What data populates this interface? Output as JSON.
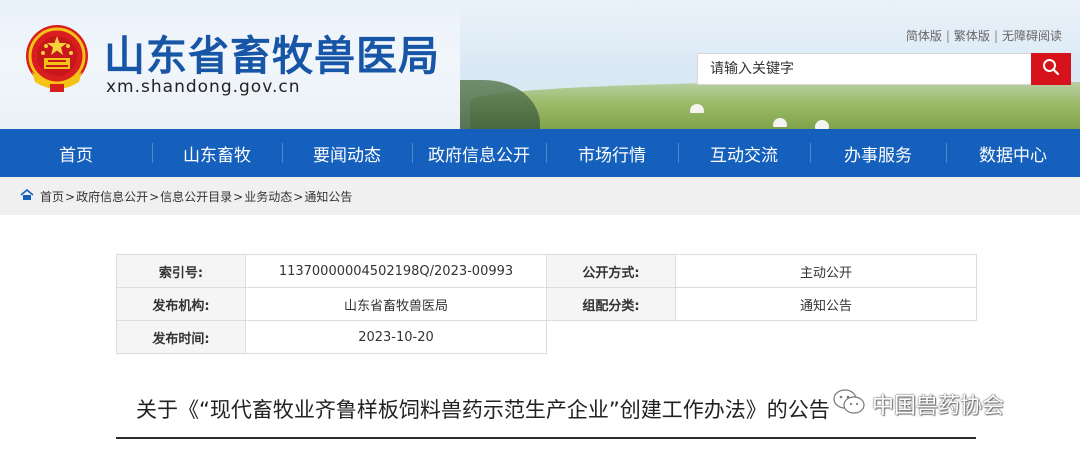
{
  "site": {
    "title": "山东省畜牧兽医局",
    "domain": "xm.shandong.gov.cn"
  },
  "top_links": {
    "simplified": "简体版",
    "traditional": "繁体版",
    "accessible": "无障碍阅读",
    "separator": "|"
  },
  "search": {
    "placeholder": "请输入关键字",
    "button_icon": "search-icon"
  },
  "nav": {
    "items": [
      {
        "label": "首页"
      },
      {
        "label": "山东畜牧"
      },
      {
        "label": "要闻动态"
      },
      {
        "label": "政府信息公开"
      },
      {
        "label": "市场行情"
      },
      {
        "label": "互动交流"
      },
      {
        "label": "办事服务"
      },
      {
        "label": "数据中心"
      }
    ]
  },
  "breadcrumb": {
    "home_icon": "home-icon",
    "items": [
      "首页",
      "政府信息公开",
      "信息公开目录",
      "业务动态",
      "通知公告"
    ],
    "separator": ">"
  },
  "info": {
    "index_label": "索引号:",
    "index_value": "11370000004502198Q/2023-00993",
    "public_method_label": "公开方式:",
    "public_method_value": "主动公开",
    "publisher_label": "发布机构:",
    "publisher_value": "山东省畜牧兽医局",
    "category_label": "组配分类:",
    "category_value": "通知公告",
    "date_label": "发布时间:",
    "date_value": "2023-10-20"
  },
  "article": {
    "title": "关于《“现代畜牧业齐鲁样板饲料兽药示范生产企业”创建工作办法》的公告"
  },
  "watermark": {
    "text": "中国兽药协会",
    "icon": "wechat-icon"
  },
  "colors": {
    "nav_blue": "#1560bd",
    "title_blue": "#1755a6",
    "search_red": "#d6131b"
  }
}
